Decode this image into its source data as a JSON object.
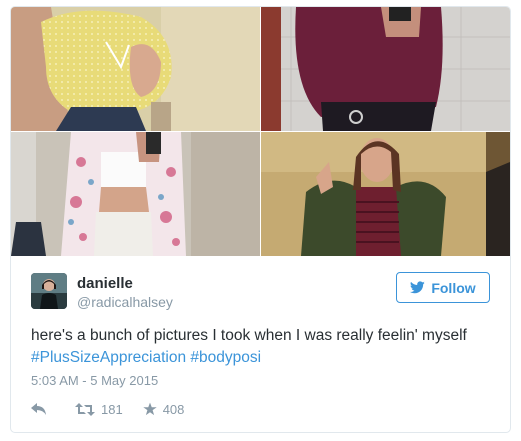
{
  "user": {
    "display_name": "danielle",
    "handle": "@radicalhalsey"
  },
  "follow_label": "Follow",
  "tweet": {
    "text": "here's a bunch of pictures I took when I was really feelin' myself",
    "hashtags": [
      "#PlusSizeAppreciation",
      "#bodyposi"
    ]
  },
  "timestamp": "5:03 AM - 5 May 2015",
  "stats": {
    "retweets": "181",
    "likes": "408"
  },
  "colors": {
    "link": "#3b94d9",
    "muted": "#8899a6",
    "text": "#292f33"
  },
  "icons": [
    "twitter-bird-icon",
    "reply-icon",
    "retweet-icon",
    "like-star-icon"
  ]
}
